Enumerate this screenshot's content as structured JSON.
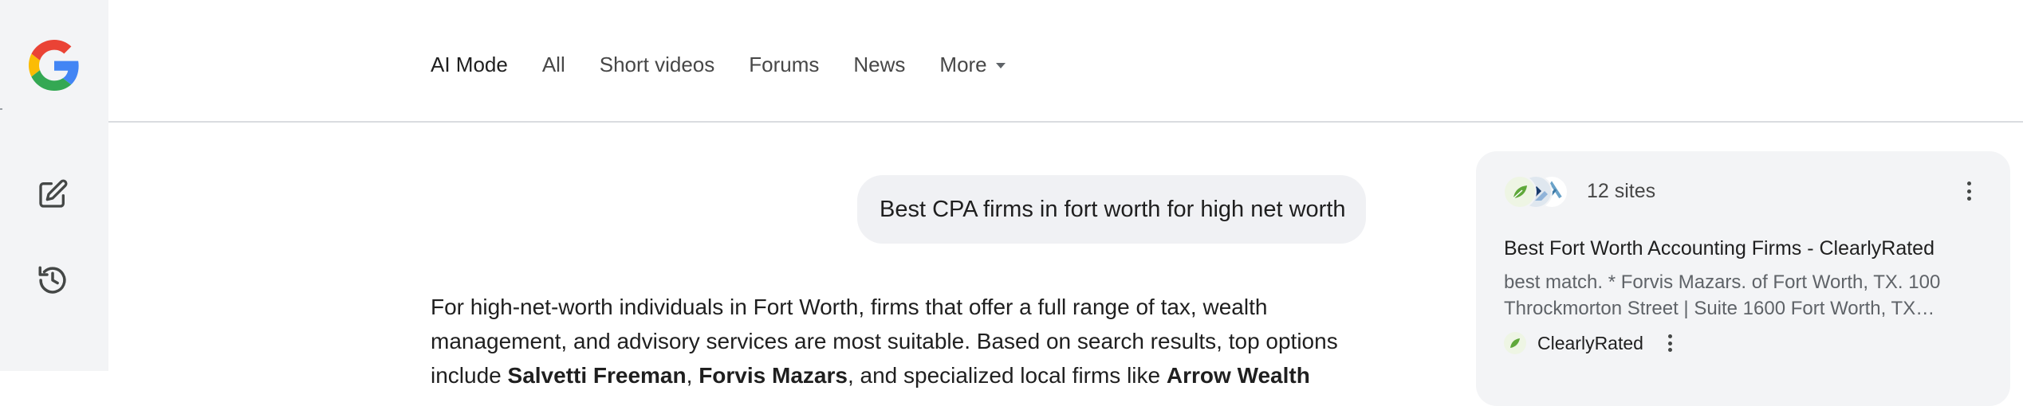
{
  "rail": {
    "logo_icon": "google-g-logo",
    "new_chat_icon": "edit-icon",
    "history_icon": "history-icon"
  },
  "nav": {
    "tabs": [
      {
        "label": "AI Mode",
        "active": true
      },
      {
        "label": "All"
      },
      {
        "label": "Short videos"
      },
      {
        "label": "Forums"
      },
      {
        "label": "News"
      }
    ],
    "more_label": "More"
  },
  "query": {
    "text": "Best CPA firms in fort worth for high net worth"
  },
  "answer": {
    "line1": "For high-net-worth individuals in Fort Worth, firms that offer a full range of tax, wealth",
    "line2": "management, and advisory services are most suitable. Based on search results, top options",
    "line3_start": "include ",
    "line3_firm1": "Salvetti Freeman",
    "line3_mid1": ", ",
    "line3_firm2": "Forvis Mazars",
    "line3_mid2": ", and specialized local firms like ",
    "line3_firm3": "Arrow Wealth"
  },
  "sources": {
    "count_label": "12 sites",
    "item": {
      "title": "Best Fort Worth Accounting Firms - ClearlyRated",
      "snippet": "best match. * Forvis Mazars. of Fort Worth, TX. 100 Throckmorton Street | Suite 1600 Fort Worth, TX…",
      "site_name": "ClearlyRated"
    }
  },
  "colors": {
    "rail_bg": "#f3f4f6",
    "bubble_bg": "#f0f1f4",
    "panel_bg": "#f3f4f6",
    "text_primary": "#1f1f1f",
    "text_secondary": "#5f6368",
    "divider": "#dadce0"
  }
}
